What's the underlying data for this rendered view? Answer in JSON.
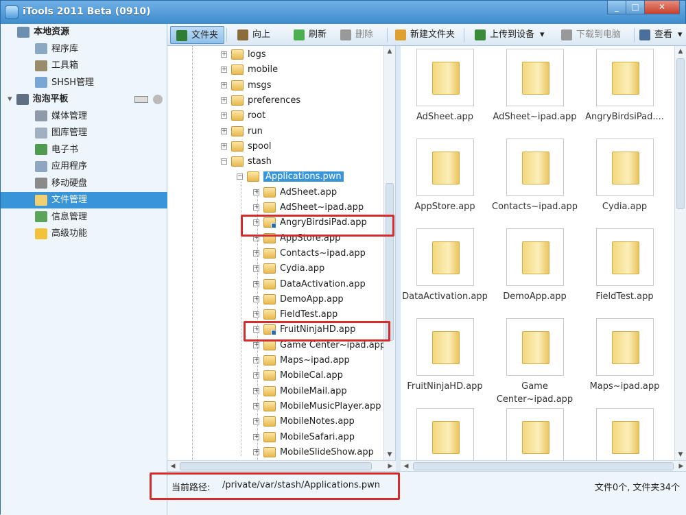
{
  "window": {
    "title": "iTools 2011 Beta (0910)",
    "min_label": "_",
    "max_label": "□",
    "close_label": "✕"
  },
  "sidebar": {
    "groups": [
      {
        "label": "本地资源",
        "icon": "computer-icon",
        "items": [
          {
            "label": "程序库",
            "icon": "library-icon"
          },
          {
            "label": "工具箱",
            "icon": "tools-icon"
          },
          {
            "label": "SHSH管理",
            "icon": "shsh-icon"
          }
        ]
      },
      {
        "label": "泡泡平板",
        "icon": "tablet-icon",
        "items": [
          {
            "label": "媒体管理",
            "icon": "media-icon"
          },
          {
            "label": "图库管理",
            "icon": "photos-icon"
          },
          {
            "label": "电子书",
            "icon": "ebook-icon"
          },
          {
            "label": "应用程序",
            "icon": "apps-icon"
          },
          {
            "label": "移动硬盘",
            "icon": "disk-icon"
          },
          {
            "label": "文件管理",
            "icon": "folder-icon",
            "selected": true
          },
          {
            "label": "信息管理",
            "icon": "contacts-icon"
          },
          {
            "label": "高级功能",
            "icon": "star-icon"
          }
        ]
      }
    ]
  },
  "toolbar": {
    "items": [
      {
        "label": "文件夹",
        "icon": "folder-view-icon"
      },
      {
        "label": "向上",
        "icon": "up-folder-icon"
      },
      {
        "label": "刷新",
        "icon": "refresh-icon"
      },
      {
        "label": "删除",
        "icon": "delete-icon"
      },
      {
        "label": "新建文件夹",
        "icon": "new-folder-icon"
      },
      {
        "label": "上传到设备",
        "icon": "upload-icon"
      },
      {
        "label": "下载到电脑",
        "icon": "download-icon"
      },
      {
        "label": "查看",
        "icon": "view-icon"
      }
    ],
    "upload_arrow": "▾",
    "view_arrow": "▾"
  },
  "tree": {
    "top_level": [
      "logs",
      "mobile",
      "msgs",
      "preferences",
      "root",
      "run",
      "spool",
      "stash"
    ],
    "selected_folder": "Applications.pwn",
    "children": [
      "AdSheet.app",
      "AdSheet~ipad.app",
      "AngryBirdsiPad.app",
      "AppStore.app",
      "Contacts~ipad.app",
      "Cydia.app",
      "DataActivation.app",
      "DemoApp.app",
      "FieldTest.app",
      "FruitNinjaHD.app",
      "Game Center~ipad.app",
      "Maps~ipad.app",
      "MobileCal.app",
      "MobileMail.app",
      "MobileMusicPlayer.app",
      "MobileNotes.app",
      "MobileSafari.app",
      "MobileSlideShow.app"
    ],
    "link_items": [
      "AngryBirdsiPad.app",
      "FruitNinjaHD.app"
    ],
    "expand_symbol": "+",
    "collapse_symbol": "−"
  },
  "grid": {
    "items": [
      "AdSheet.app",
      "AdSheet~ipad.app",
      "AngryBirdsiPad....",
      "AppStore.app",
      "Contacts~ipad.app",
      "Cydia.app",
      "DataActivation.app",
      "DemoApp.app",
      "FieldTest.app",
      "FruitNinjaHD.app",
      "Game Center~ipad.app",
      "Maps~ipad.app",
      "",
      "",
      ""
    ]
  },
  "status": {
    "path_label": "当前路径:",
    "path_value": "/private/var/stash/Applications.pwn",
    "counts": "文件0个, 文件夹34个"
  },
  "scroll": {
    "up": "▲",
    "down": "▼",
    "left": "◀",
    "right": "▶"
  },
  "colors": {
    "highlight_box": "#d42c2c",
    "selection": "#3a95d8"
  }
}
